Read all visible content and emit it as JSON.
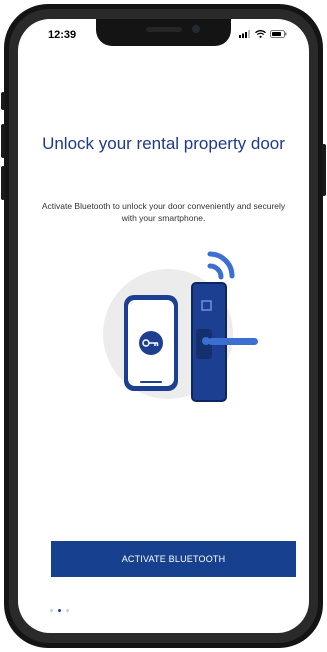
{
  "status_bar": {
    "time": "12:39",
    "icons": [
      "signal-icon",
      "wifi-icon",
      "battery-icon"
    ]
  },
  "onboarding": {
    "title": "Unlock your rental property door",
    "subtitle": "Activate Bluetooth to unlock your door conveniently and securely with your smartphone.",
    "cta_label": "ACTIVATE BLUETOOTH",
    "pagination": {
      "total": 3,
      "active": 1
    }
  },
  "colors": {
    "brand": "#17408f",
    "title": "#1e3a8a",
    "accent_light": "#3b6fd1",
    "illustration_bg": "#ececec"
  },
  "illustration_icons": [
    "bluetooth-waves-icon",
    "key-icon",
    "smartphone-icon",
    "door-lock-icon"
  ]
}
